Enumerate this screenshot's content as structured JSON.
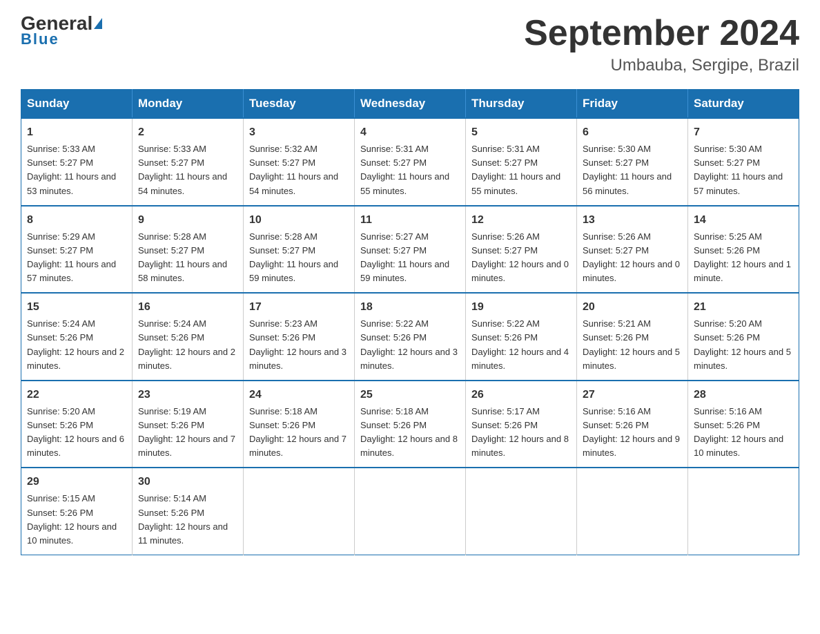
{
  "header": {
    "logo_general": "General",
    "logo_blue": "Blue",
    "month_title": "September 2024",
    "location": "Umbauba, Sergipe, Brazil"
  },
  "calendar": {
    "days_of_week": [
      "Sunday",
      "Monday",
      "Tuesday",
      "Wednesday",
      "Thursday",
      "Friday",
      "Saturday"
    ],
    "weeks": [
      [
        {
          "day": "1",
          "sunrise": "5:33 AM",
          "sunset": "5:27 PM",
          "daylight": "11 hours and 53 minutes."
        },
        {
          "day": "2",
          "sunrise": "5:33 AM",
          "sunset": "5:27 PM",
          "daylight": "11 hours and 54 minutes."
        },
        {
          "day": "3",
          "sunrise": "5:32 AM",
          "sunset": "5:27 PM",
          "daylight": "11 hours and 54 minutes."
        },
        {
          "day": "4",
          "sunrise": "5:31 AM",
          "sunset": "5:27 PM",
          "daylight": "11 hours and 55 minutes."
        },
        {
          "day": "5",
          "sunrise": "5:31 AM",
          "sunset": "5:27 PM",
          "daylight": "11 hours and 55 minutes."
        },
        {
          "day": "6",
          "sunrise": "5:30 AM",
          "sunset": "5:27 PM",
          "daylight": "11 hours and 56 minutes."
        },
        {
          "day": "7",
          "sunrise": "5:30 AM",
          "sunset": "5:27 PM",
          "daylight": "11 hours and 57 minutes."
        }
      ],
      [
        {
          "day": "8",
          "sunrise": "5:29 AM",
          "sunset": "5:27 PM",
          "daylight": "11 hours and 57 minutes."
        },
        {
          "day": "9",
          "sunrise": "5:28 AM",
          "sunset": "5:27 PM",
          "daylight": "11 hours and 58 minutes."
        },
        {
          "day": "10",
          "sunrise": "5:28 AM",
          "sunset": "5:27 PM",
          "daylight": "11 hours and 59 minutes."
        },
        {
          "day": "11",
          "sunrise": "5:27 AM",
          "sunset": "5:27 PM",
          "daylight": "11 hours and 59 minutes."
        },
        {
          "day": "12",
          "sunrise": "5:26 AM",
          "sunset": "5:27 PM",
          "daylight": "12 hours and 0 minutes."
        },
        {
          "day": "13",
          "sunrise": "5:26 AM",
          "sunset": "5:27 PM",
          "daylight": "12 hours and 0 minutes."
        },
        {
          "day": "14",
          "sunrise": "5:25 AM",
          "sunset": "5:26 PM",
          "daylight": "12 hours and 1 minute."
        }
      ],
      [
        {
          "day": "15",
          "sunrise": "5:24 AM",
          "sunset": "5:26 PM",
          "daylight": "12 hours and 2 minutes."
        },
        {
          "day": "16",
          "sunrise": "5:24 AM",
          "sunset": "5:26 PM",
          "daylight": "12 hours and 2 minutes."
        },
        {
          "day": "17",
          "sunrise": "5:23 AM",
          "sunset": "5:26 PM",
          "daylight": "12 hours and 3 minutes."
        },
        {
          "day": "18",
          "sunrise": "5:22 AM",
          "sunset": "5:26 PM",
          "daylight": "12 hours and 3 minutes."
        },
        {
          "day": "19",
          "sunrise": "5:22 AM",
          "sunset": "5:26 PM",
          "daylight": "12 hours and 4 minutes."
        },
        {
          "day": "20",
          "sunrise": "5:21 AM",
          "sunset": "5:26 PM",
          "daylight": "12 hours and 5 minutes."
        },
        {
          "day": "21",
          "sunrise": "5:20 AM",
          "sunset": "5:26 PM",
          "daylight": "12 hours and 5 minutes."
        }
      ],
      [
        {
          "day": "22",
          "sunrise": "5:20 AM",
          "sunset": "5:26 PM",
          "daylight": "12 hours and 6 minutes."
        },
        {
          "day": "23",
          "sunrise": "5:19 AM",
          "sunset": "5:26 PM",
          "daylight": "12 hours and 7 minutes."
        },
        {
          "day": "24",
          "sunrise": "5:18 AM",
          "sunset": "5:26 PM",
          "daylight": "12 hours and 7 minutes."
        },
        {
          "day": "25",
          "sunrise": "5:18 AM",
          "sunset": "5:26 PM",
          "daylight": "12 hours and 8 minutes."
        },
        {
          "day": "26",
          "sunrise": "5:17 AM",
          "sunset": "5:26 PM",
          "daylight": "12 hours and 8 minutes."
        },
        {
          "day": "27",
          "sunrise": "5:16 AM",
          "sunset": "5:26 PM",
          "daylight": "12 hours and 9 minutes."
        },
        {
          "day": "28",
          "sunrise": "5:16 AM",
          "sunset": "5:26 PM",
          "daylight": "12 hours and 10 minutes."
        }
      ],
      [
        {
          "day": "29",
          "sunrise": "5:15 AM",
          "sunset": "5:26 PM",
          "daylight": "12 hours and 10 minutes."
        },
        {
          "day": "30",
          "sunrise": "5:14 AM",
          "sunset": "5:26 PM",
          "daylight": "12 hours and 11 minutes."
        },
        null,
        null,
        null,
        null,
        null
      ]
    ]
  }
}
